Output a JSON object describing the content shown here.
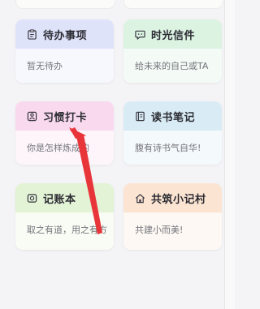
{
  "cards": [
    {
      "key": "todo",
      "title": "待办事项",
      "desc": "暂无待办",
      "icon": "clipboard-icon",
      "header_color": "#dfe3fa",
      "body_color": "#f7f8fe"
    },
    {
      "key": "letter",
      "title": "时光信件",
      "desc": "给未来的自己或TA",
      "icon": "chat-bubble-icon",
      "header_color": "#dcf3e2",
      "body_color": "#f4fbf6"
    },
    {
      "key": "habit",
      "title": "习惯打卡",
      "desc": "你是怎样炼成的",
      "icon": "checkin-icon",
      "header_color": "#f9d9ee",
      "body_color": "#fdf5fa"
    },
    {
      "key": "reading",
      "title": "读书笔记",
      "desc": "腹有诗书气自华!",
      "icon": "notebook-icon",
      "header_color": "#d9ecf5",
      "body_color": "#f4f9fc"
    },
    {
      "key": "ledger",
      "title": "记账本",
      "desc": "取之有道，用之有方",
      "icon": "coin-icon",
      "header_color": "#e3f3d6",
      "body_color": "#f8fcf4"
    },
    {
      "key": "village",
      "title": "共筑小记村",
      "desc": "共建小而美!",
      "icon": "house-icon",
      "header_color": "#fbe4d2",
      "body_color": "#fdf8f3"
    }
  ],
  "annotation_arrow_color": "#e8353a"
}
